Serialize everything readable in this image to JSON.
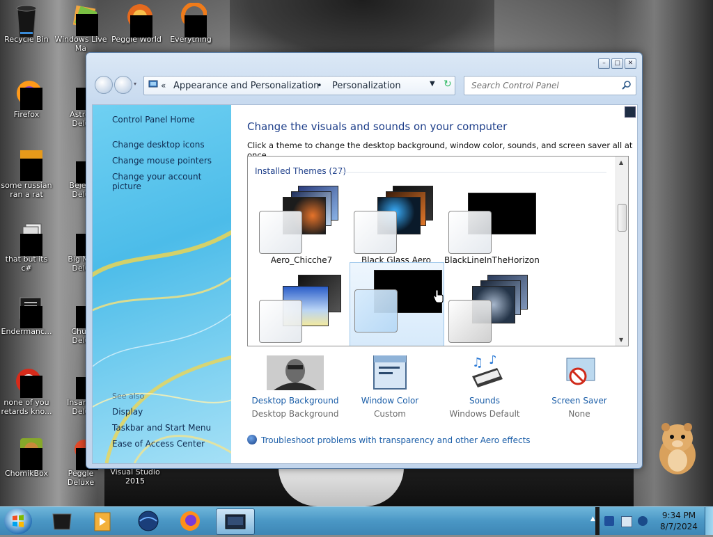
{
  "desktop": {
    "icons": [
      {
        "label": "Recycle Bin"
      },
      {
        "label": "Windows Live\nMa"
      },
      {
        "label": "Peggle World"
      },
      {
        "label": "Everything"
      },
      {
        "label": "Firefox"
      },
      {
        "label": "Astrol\nDelu"
      },
      {
        "label": "some russian\nran a rat"
      },
      {
        "label": "Bejew\nDelu"
      },
      {
        "label": "that but its c#"
      },
      {
        "label": "Big Mo\nDelu"
      },
      {
        "label": "Endermanc..."
      },
      {
        "label": "Chuz\nDelu"
      },
      {
        "label": "none of you\nretards kno..."
      },
      {
        "label": "Insaniq\nDelu"
      },
      {
        "label": "ChomikBox"
      },
      {
        "label": "Peggle Deluxe"
      },
      {
        "label": "Visual Studio\n2015"
      }
    ]
  },
  "window": {
    "breadcrumb_root": "«",
    "breadcrumb_1": "Appearance and Personalization",
    "breadcrumb_sep": "•",
    "breadcrumb_2": "Personalization",
    "search_placeholder": "Search Control Panel",
    "left_nav": {
      "home": "Control Panel Home",
      "desktop_icons": "Change desktop icons",
      "mouse_pointers": "Change mouse pointers",
      "account_picture": "Change your account picture",
      "see_also": "See also",
      "display": "Display",
      "taskbar": "Taskbar and Start Menu",
      "ease": "Ease of Access Center"
    },
    "main": {
      "title": "Change the visuals and sounds on your computer",
      "subtitle": "Click a theme to change the desktop background, window color, sounds, and screen saver all at once.",
      "installed_header": "Installed Themes (27)",
      "themes": [
        {
          "name": "Aero_Chicche7"
        },
        {
          "name": "Black Glass Aero"
        },
        {
          "name": "BlackLineInTheHorizon"
        },
        {
          "name": ""
        },
        {
          "name": ""
        },
        {
          "name": ""
        }
      ],
      "bottom": {
        "desktop_bg_link": "Desktop Background",
        "desktop_bg_val": "Desktop Background",
        "window_color_link": "Window Color",
        "window_color_val": "Custom",
        "sounds_link": "Sounds",
        "sounds_val": "Windows Default",
        "screensaver_link": "Screen Saver",
        "screensaver_val": "None"
      },
      "troubleshoot": "Troubleshoot problems with transparency and other Aero effects"
    }
  },
  "taskbar": {
    "time": "9:34 PM",
    "date": "8/7/2024"
  },
  "colors": {
    "link": "#1b5ea8",
    "title": "#1e3f8a",
    "taskbar": "#4a97c5"
  }
}
